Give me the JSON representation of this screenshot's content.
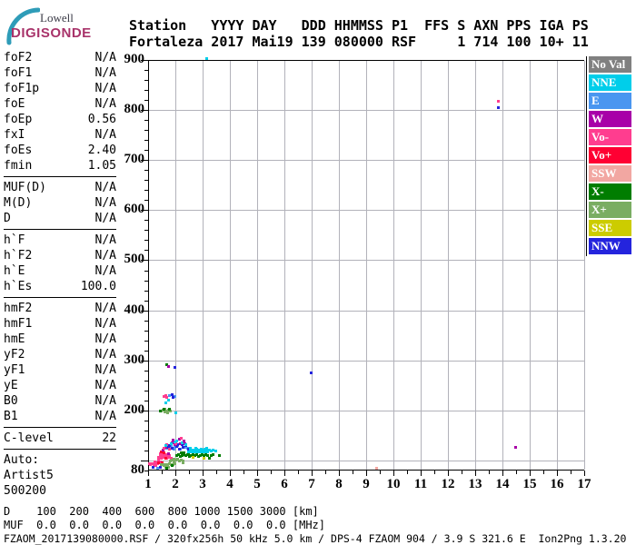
{
  "logo": {
    "line1": "Lowell",
    "line2": "DIGISONDE",
    "arc_color": "#2e9cb8",
    "brand_color": "#a8336a"
  },
  "header": {
    "line1": "Station   YYYY DAY   DDD HHMMSS P1  FFS S AXN PPS IGA PS",
    "line2": "Fortaleza 2017 Mai19 139 080000 RSF     1 714 100 10+ 11"
  },
  "params": {
    "rows": [
      {
        "l": "foF2",
        "v": "N/A"
      },
      {
        "l": "foF1",
        "v": "N/A"
      },
      {
        "l": "foF1p",
        "v": "N/A"
      },
      {
        "l": "foE",
        "v": "N/A"
      },
      {
        "l": "foEp",
        "v": "0.56"
      },
      {
        "l": "fxI",
        "v": "N/A"
      },
      {
        "l": "foEs",
        "v": "2.40"
      },
      {
        "l": "fmin",
        "v": "1.05"
      },
      {
        "l": "MUF(D)",
        "v": "N/A"
      },
      {
        "l": "M(D)",
        "v": "N/A"
      },
      {
        "l": "D",
        "v": "N/A"
      },
      {
        "l": "h`F",
        "v": "N/A"
      },
      {
        "l": "h`F2",
        "v": "N/A"
      },
      {
        "l": "h`E",
        "v": "N/A"
      },
      {
        "l": "h`Es",
        "v": "100.0"
      },
      {
        "l": "hmF2",
        "v": "N/A"
      },
      {
        "l": "hmF1",
        "v": "N/A"
      },
      {
        "l": "hmE",
        "v": "N/A"
      },
      {
        "l": "yF2",
        "v": "N/A"
      },
      {
        "l": "yF1",
        "v": "N/A"
      },
      {
        "l": "yE",
        "v": "N/A"
      },
      {
        "l": "B0",
        "v": "N/A"
      },
      {
        "l": "B1",
        "v": "N/A"
      },
      {
        "l": "C-level",
        "v": "22"
      }
    ]
  },
  "auto": {
    "line1": "Auto:",
    "line2": "Artist5",
    "line3": "500200"
  },
  "legend": {
    "items": [
      {
        "key": "NoVal",
        "label": "No Val"
      },
      {
        "key": "NNE",
        "label": "NNE"
      },
      {
        "key": "E",
        "label": "E"
      },
      {
        "key": "W",
        "label": "W"
      },
      {
        "key": "Vo-",
        "label": "Vo-"
      },
      {
        "key": "Vo+",
        "label": "Vo+"
      },
      {
        "key": "SSW",
        "label": "SSW"
      },
      {
        "key": "X-",
        "label": "X-"
      },
      {
        "key": "X+",
        "label": "X+"
      },
      {
        "key": "SSE",
        "label": "SSE"
      },
      {
        "key": "NNW",
        "label": "NNW"
      }
    ]
  },
  "bottom": {
    "d_line": "D    100  200  400  600  800 1000 1500 3000 [km]",
    "muf_line": "MUF  0.0  0.0  0.0  0.0  0.0  0.0  0.0  0.0 [MHz]",
    "footer": "FZAOM_2017139080000.RSF / 320fx256h 50 kHz 5.0 km / DPS-4 FZAOM 904 / 3.9 S 321.6 E  Ion2Png 1.3.20"
  },
  "chart_data": {
    "type": "scatter",
    "title": "",
    "x_unit": "MHz",
    "y_unit": "km",
    "xlim": [
      1,
      17
    ],
    "ylim": [
      80,
      900
    ],
    "grid": true,
    "x_tick_labels": [
      "1",
      "2",
      "3",
      "4",
      "5",
      "6",
      "7",
      "8",
      "9",
      "10",
      "11",
      "12",
      "13",
      "14",
      "15",
      "16",
      "17"
    ],
    "y_tick_labels": [
      "900",
      "800",
      "700",
      "600",
      "500",
      "400",
      "300",
      "200",
      "80"
    ],
    "colors": {
      "NoVal": "#808080",
      "NNE": "#00ceea",
      "E": "#4a96f0",
      "W": "#a800a8",
      "Vo-": "#ff3d8f",
      "Vo+": "#ff0033",
      "SSW": "#f2a7a2",
      "X-": "#007d00",
      "X+": "#7aad62",
      "SSE": "#cccc00",
      "NNW": "#2424dd"
    },
    "points": [
      [
        1.03,
        94,
        "Vo-"
      ],
      [
        1.08,
        92,
        "Vo-"
      ],
      [
        1.13,
        95,
        "Vo-"
      ],
      [
        1.2,
        93,
        "Vo-"
      ],
      [
        1.27,
        96,
        "Vo-"
      ],
      [
        1.33,
        94,
        "Vo-"
      ],
      [
        1.22,
        99,
        "Vo-"
      ],
      [
        1.35,
        101,
        "Vo-"
      ],
      [
        1.42,
        98,
        "Vo-"
      ],
      [
        1.28,
        91,
        "Vo-"
      ],
      [
        1.5,
        97,
        "Vo+"
      ],
      [
        1.38,
        96,
        "Vo+"
      ],
      [
        1.17,
        87,
        "NNW"
      ],
      [
        1.42,
        87,
        "NNW"
      ],
      [
        1.32,
        86,
        "E"
      ],
      [
        1.45,
        92,
        "X+"
      ],
      [
        1.52,
        93,
        "X+"
      ],
      [
        1.58,
        91,
        "X+"
      ],
      [
        1.64,
        93,
        "X+"
      ],
      [
        1.7,
        92,
        "X+"
      ],
      [
        1.77,
        94,
        "X+"
      ],
      [
        1.83,
        92,
        "X+"
      ],
      [
        1.9,
        93,
        "X+"
      ],
      [
        1.63,
        87,
        "X+"
      ],
      [
        1.72,
        88,
        "X+"
      ],
      [
        1.97,
        95,
        "X+"
      ],
      [
        2.25,
        96,
        "X+"
      ],
      [
        1.68,
        86,
        "X-"
      ],
      [
        1.87,
        90,
        "X-"
      ],
      [
        1.38,
        107,
        "Vo-"
      ],
      [
        1.43,
        109,
        "Vo-"
      ],
      [
        1.48,
        106,
        "Vo-"
      ],
      [
        1.53,
        110,
        "Vo-"
      ],
      [
        1.58,
        107,
        "Vo-"
      ],
      [
        1.63,
        109,
        "Vo-"
      ],
      [
        1.68,
        106,
        "Vo-"
      ],
      [
        1.73,
        108,
        "Vo-"
      ],
      [
        1.78,
        111,
        "Vo-"
      ],
      [
        1.48,
        113,
        "Vo-"
      ],
      [
        1.58,
        114,
        "Vo-"
      ],
      [
        1.68,
        112,
        "Vo-"
      ],
      [
        1.42,
        115,
        "Vo-"
      ],
      [
        1.82,
        106,
        "Vo-"
      ],
      [
        1.55,
        117,
        "Vo+"
      ],
      [
        1.62,
        105,
        "Vo+"
      ],
      [
        1.45,
        119,
        "Vo+"
      ],
      [
        1.52,
        121,
        "W"
      ],
      [
        1.73,
        115,
        "W"
      ],
      [
        1.8,
        100,
        "X+"
      ],
      [
        1.87,
        102,
        "X+"
      ],
      [
        1.93,
        99,
        "X+"
      ],
      [
        2.0,
        101,
        "X+"
      ],
      [
        2.07,
        103,
        "X+"
      ],
      [
        2.13,
        100,
        "X+"
      ],
      [
        1.93,
        104,
        "X+"
      ],
      [
        2.2,
        102,
        "X+"
      ],
      [
        2.28,
        100,
        "X+"
      ],
      [
        2.02,
        110,
        "X-"
      ],
      [
        2.1,
        112,
        "X-"
      ],
      [
        2.17,
        109,
        "X-"
      ],
      [
        2.23,
        111,
        "X-"
      ],
      [
        2.3,
        113,
        "X-"
      ],
      [
        2.37,
        110,
        "X-"
      ],
      [
        2.43,
        112,
        "X-"
      ],
      [
        2.5,
        109,
        "X-"
      ],
      [
        2.57,
        111,
        "X-"
      ],
      [
        2.63,
        113,
        "X-"
      ],
      [
        2.7,
        110,
        "X-"
      ],
      [
        2.77,
        112,
        "X-"
      ],
      [
        2.83,
        109,
        "X-"
      ],
      [
        2.9,
        111,
        "X-"
      ],
      [
        2.97,
        113,
        "X-"
      ],
      [
        3.03,
        110,
        "X-"
      ],
      [
        3.1,
        112,
        "X-"
      ],
      [
        3.17,
        110,
        "X-"
      ],
      [
        3.3,
        111,
        "X-"
      ],
      [
        3.37,
        112,
        "X-"
      ],
      [
        2.3,
        116,
        "X-"
      ],
      [
        2.2,
        117,
        "X-"
      ],
      [
        2.45,
        115,
        "X-"
      ],
      [
        3.24,
        106,
        "X-"
      ],
      [
        3.6,
        111,
        "X-"
      ],
      [
        2.62,
        107,
        "SSE"
      ],
      [
        3.02,
        106,
        "SSE"
      ],
      [
        1.67,
        125,
        "E"
      ],
      [
        1.83,
        129,
        "E"
      ],
      [
        1.97,
        127,
        "E"
      ],
      [
        2.08,
        130,
        "E"
      ],
      [
        2.18,
        124,
        "E"
      ],
      [
        2.32,
        128,
        "E"
      ],
      [
        2.42,
        125,
        "E"
      ],
      [
        1.92,
        123,
        "E"
      ],
      [
        1.73,
        128,
        "NNW"
      ],
      [
        1.88,
        125,
        "NNW"
      ],
      [
        2.02,
        129,
        "NNW"
      ],
      [
        2.12,
        123,
        "NNW"
      ],
      [
        2.27,
        127,
        "NNW"
      ],
      [
        2.37,
        130,
        "NNW"
      ],
      [
        2.47,
        124,
        "NNW"
      ],
      [
        1.78,
        131,
        "NNW"
      ],
      [
        2.07,
        133,
        "NNW"
      ],
      [
        2.22,
        132,
        "NNW"
      ],
      [
        1.62,
        127,
        "W"
      ],
      [
        1.95,
        132,
        "W"
      ],
      [
        2.15,
        135,
        "W"
      ],
      [
        2.33,
        134,
        "W"
      ],
      [
        1.85,
        136,
        "W"
      ],
      [
        2.52,
        122,
        "W"
      ],
      [
        1.57,
        126,
        "Vo-"
      ],
      [
        1.77,
        123,
        "Vo-"
      ],
      [
        2.0,
        135,
        "Vo-"
      ],
      [
        1.67,
        133,
        "Vo-"
      ],
      [
        1.62,
        131,
        "NNE"
      ],
      [
        1.82,
        134,
        "NNE"
      ],
      [
        2.22,
        136,
        "NNE"
      ],
      [
        1.95,
        138,
        "NNE"
      ],
      [
        2.35,
        133,
        "NNE"
      ],
      [
        2.48,
        119,
        "NNE"
      ],
      [
        2.53,
        121,
        "NNE"
      ],
      [
        2.58,
        118,
        "NNE"
      ],
      [
        2.58,
        122,
        "NNE"
      ],
      [
        2.63,
        120,
        "NNE"
      ],
      [
        2.68,
        118,
        "NNE"
      ],
      [
        2.68,
        122,
        "NNE"
      ],
      [
        2.73,
        120,
        "NNE"
      ],
      [
        2.78,
        118,
        "NNE"
      ],
      [
        2.78,
        123,
        "NNE"
      ],
      [
        2.83,
        121,
        "NNE"
      ],
      [
        2.88,
        119,
        "NNE"
      ],
      [
        2.92,
        122,
        "NNE"
      ],
      [
        2.97,
        119,
        "NNE"
      ],
      [
        3.02,
        121,
        "NNE"
      ],
      [
        3.07,
        119,
        "NNE"
      ],
      [
        3.07,
        123,
        "NNE"
      ],
      [
        3.12,
        121,
        "NNE"
      ],
      [
        3.17,
        119,
        "NNE"
      ],
      [
        3.22,
        121,
        "NNE"
      ],
      [
        3.3,
        120,
        "NNE"
      ],
      [
        3.38,
        121,
        "NNE"
      ],
      [
        2.53,
        125,
        "NNE"
      ],
      [
        2.73,
        125,
        "NNE"
      ],
      [
        2.93,
        124,
        "NNE"
      ],
      [
        3.13,
        125,
        "NNE"
      ],
      [
        3.45,
        120,
        "NNE"
      ],
      [
        1.9,
        141,
        "W"
      ],
      [
        2.12,
        143,
        "W"
      ],
      [
        2.3,
        139,
        "W"
      ],
      [
        2.03,
        140,
        "NNE"
      ],
      [
        2.2,
        145,
        "Vo-"
      ],
      [
        1.47,
        199,
        "X+"
      ],
      [
        1.53,
        201,
        "X+"
      ],
      [
        1.6,
        198,
        "X+"
      ],
      [
        1.67,
        200,
        "X+"
      ],
      [
        1.73,
        202,
        "X+"
      ],
      [
        1.8,
        199,
        "X+"
      ],
      [
        1.6,
        203,
        "X+"
      ],
      [
        1.7,
        196,
        "X+"
      ],
      [
        1.55,
        204,
        "X-"
      ],
      [
        1.77,
        203,
        "X-"
      ],
      [
        1.42,
        200,
        "X-"
      ],
      [
        2.0,
        197,
        "NNE"
      ],
      [
        1.57,
        229,
        "Vo-"
      ],
      [
        1.63,
        231,
        "Vo-"
      ],
      [
        1.68,
        227,
        "Vo-"
      ],
      [
        1.78,
        231,
        "E"
      ],
      [
        1.95,
        229,
        "E"
      ],
      [
        1.85,
        232,
        "NNW"
      ],
      [
        1.9,
        227,
        "NNW"
      ],
      [
        1.73,
        222,
        "NNE"
      ],
      [
        1.63,
        216,
        "NNE"
      ],
      [
        1.68,
        292,
        "X-"
      ],
      [
        1.74,
        288,
        "W"
      ],
      [
        1.97,
        286,
        "NNW"
      ],
      [
        6.97,
        276,
        "NNW"
      ],
      [
        13.83,
        818,
        "Vo-"
      ],
      [
        13.83,
        806,
        "NNW"
      ],
      [
        14.45,
        127,
        "W"
      ],
      [
        3.13,
        903,
        "NNE"
      ],
      [
        9.35,
        86,
        "SSW"
      ]
    ]
  }
}
